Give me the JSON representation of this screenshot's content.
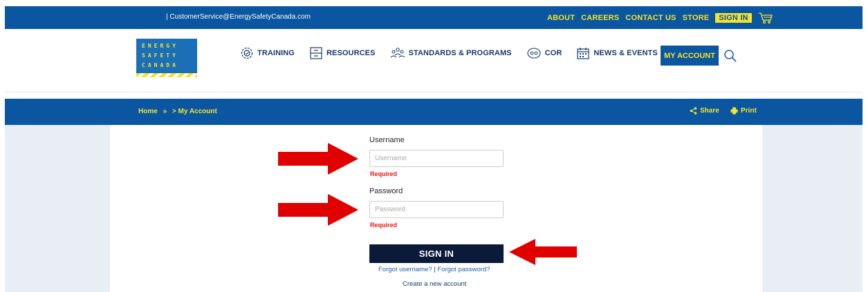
{
  "topbar": {
    "email": "| CustomerService@EnergySafetyCanada.com",
    "links": {
      "about": "ABOUT",
      "careers": "CAREERS",
      "contact": "CONTACT US",
      "store": "STORE",
      "signin": "SIGN IN"
    },
    "cart_icon": "cart-icon"
  },
  "logo": {
    "line1": "ENERGY",
    "line2": "SAFETY",
    "line3": "CANADA"
  },
  "nav": {
    "training": "TRAINING",
    "resources": "RESOURCES",
    "standards": "STANDARDS & PROGRAMS",
    "cor": "COR",
    "news": "NEWS & EVENTS",
    "my_account": "MY ACCOUNT",
    "search_icon": "search-icon"
  },
  "breadcrumb": {
    "home": "Home",
    "sep1": "»",
    "current": "> My Account",
    "share": "Share",
    "print": "Print"
  },
  "form": {
    "username_label": "Username",
    "username_placeholder": "Username",
    "username_required": "Required",
    "password_label": "Password",
    "password_placeholder": "Password",
    "password_required": "Required",
    "signin_button": "SIGN IN",
    "forgot_username": "Forgot username?",
    "pipe": "|",
    "forgot_password": "Forgot password?",
    "create_account": "Create a new account"
  },
  "colors": {
    "brand_blue": "#0a56a0",
    "brand_yellow": "#f5e32a",
    "button_dark": "#0c1a3a",
    "required_red": "#e11111",
    "arrow_red": "#e00000"
  }
}
